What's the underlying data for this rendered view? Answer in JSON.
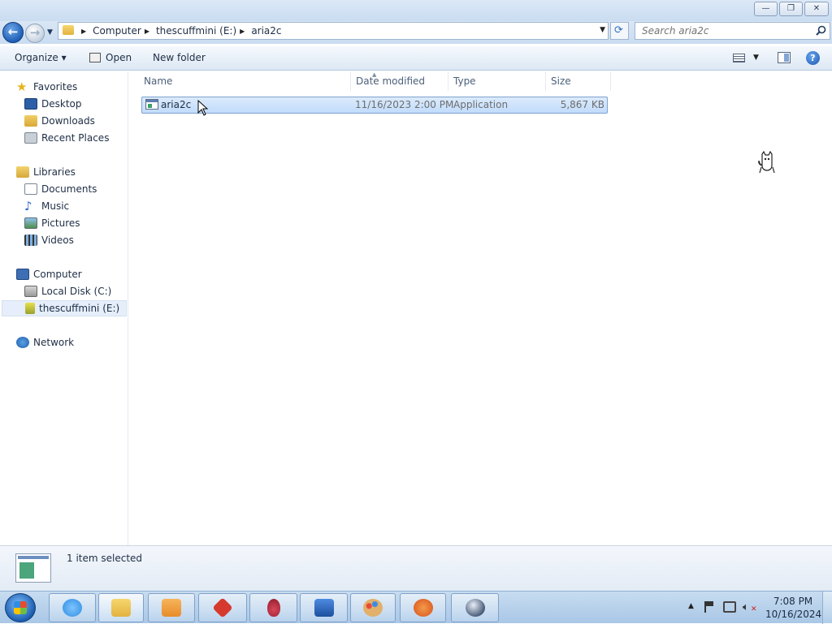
{
  "window": {
    "minimize_glyph": "—",
    "maximize_glyph": "❐",
    "close_glyph": "✕"
  },
  "nav": {
    "back_glyph": "←",
    "forward_glyph": "→",
    "recent_glyph": "▼"
  },
  "address": {
    "crumbs": [
      "Computer",
      "thescuffmini (E:)",
      "aria2c"
    ],
    "dropdown_glyph": "▼"
  },
  "refresh": {
    "glyph": "⟳"
  },
  "search": {
    "placeholder": "Search aria2c"
  },
  "toolbar": {
    "organize_label": "Organize ▾",
    "open_label": "Open",
    "new_folder_label": "New folder",
    "views_dropdown_glyph": "▼",
    "help_glyph": "?"
  },
  "sidebar": {
    "favorites": {
      "label": "Favorites",
      "items": [
        {
          "label": "Desktop",
          "icon": "desktop-icon"
        },
        {
          "label": "Downloads",
          "icon": "downloads-icon"
        },
        {
          "label": "Recent Places",
          "icon": "recent-places-icon"
        }
      ]
    },
    "libraries": {
      "label": "Libraries",
      "items": [
        {
          "label": "Documents",
          "icon": "documents-icon"
        },
        {
          "label": "Music",
          "icon": "music-icon"
        },
        {
          "label": "Pictures",
          "icon": "pictures-icon"
        },
        {
          "label": "Videos",
          "icon": "videos-icon"
        }
      ]
    },
    "computer": {
      "label": "Computer",
      "items": [
        {
          "label": "Local Disk (C:)",
          "icon": "local-disk-icon"
        },
        {
          "label": "thescuffmini (E:)",
          "icon": "usb-drive-icon",
          "selected": true
        }
      ]
    },
    "network": {
      "label": "Network"
    }
  },
  "file_list": {
    "columns": [
      "Name",
      "Date modified",
      "Type",
      "Size"
    ],
    "rows": [
      {
        "name": "aria2c",
        "date_modified": "11/16/2023 2:00 PM",
        "type": "Application",
        "size": "5,867 KB",
        "selected": true
      }
    ]
  },
  "details_pane": {
    "status": "1 item selected"
  },
  "taskbar": {
    "pinned": [
      {
        "name": "internet-explorer",
        "color": "#2f8de0"
      },
      {
        "name": "windows-explorer",
        "color": "#e9c34f",
        "active": true
      },
      {
        "name": "media-player",
        "color": "#e78c2b"
      },
      {
        "name": "red-app",
        "color": "#d63a2f"
      },
      {
        "name": "red-fruit-app",
        "color": "#b52a3a"
      },
      {
        "name": "blue-building-app",
        "color": "#2a63b7"
      },
      {
        "name": "paint",
        "color": "#d99a4a"
      },
      {
        "name": "paint-brush-app",
        "color": "#e2662a"
      },
      {
        "name": "sphere-app",
        "color": "#4b5d7a"
      }
    ],
    "tray_arrow": "▲",
    "clock": {
      "time": "7:08 PM",
      "date": "10/16/2024"
    }
  }
}
